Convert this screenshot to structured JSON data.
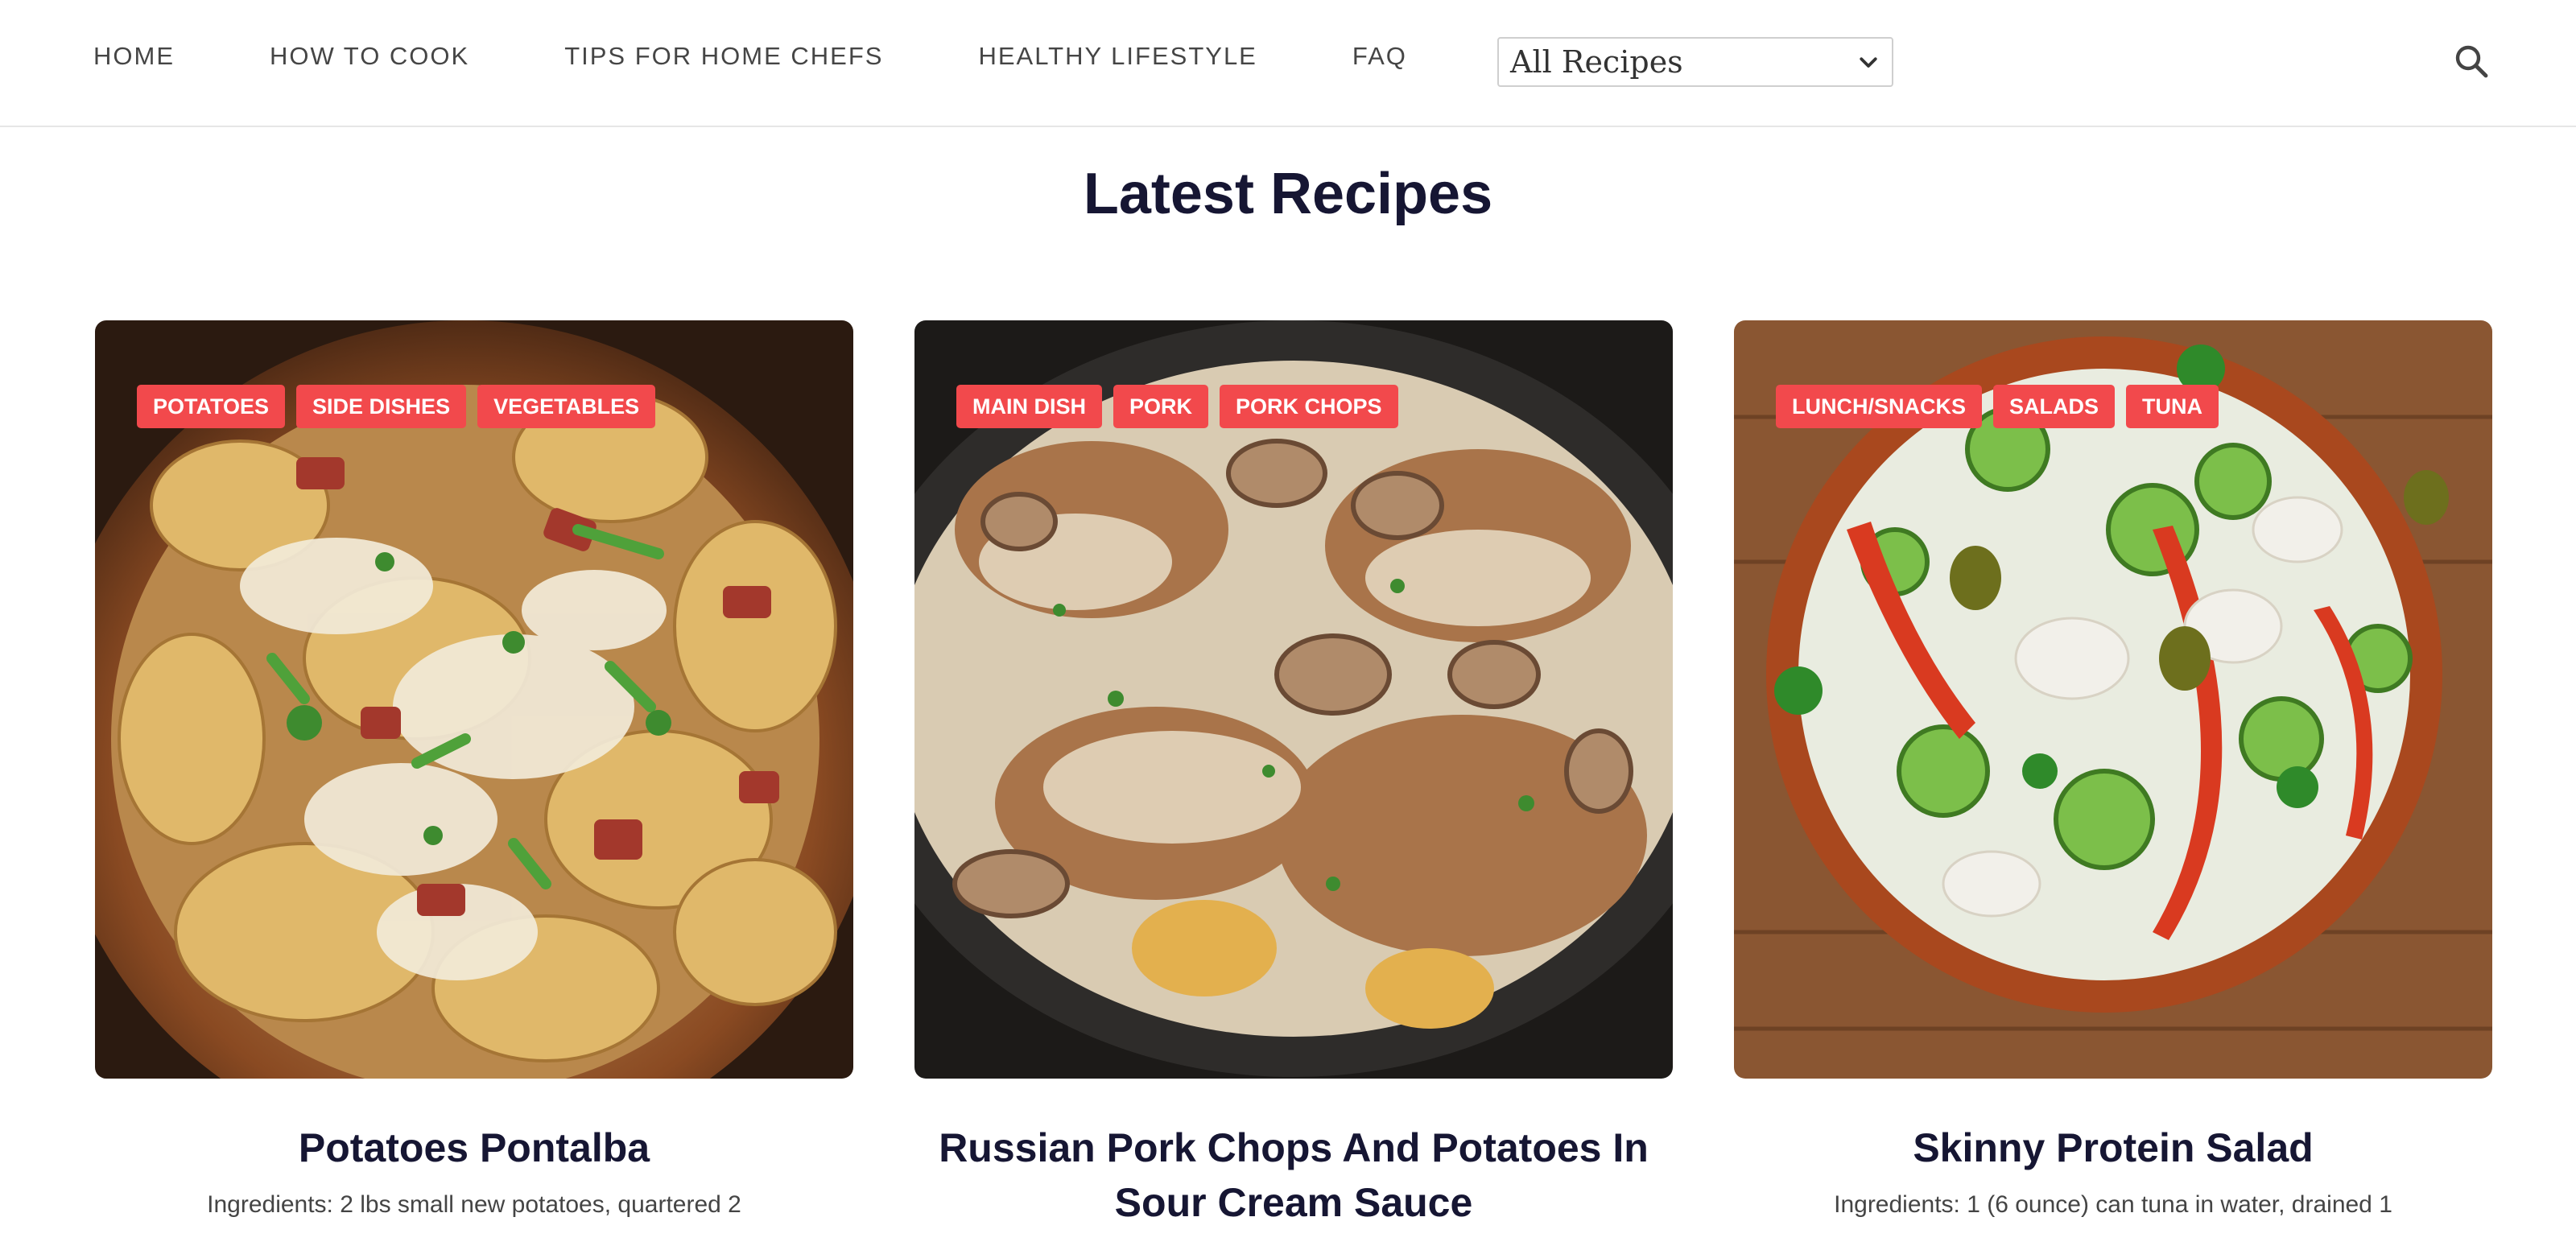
{
  "nav": {
    "items": [
      {
        "label": "HOME"
      },
      {
        "label": "HOW TO COOK"
      },
      {
        "label": "TIPS FOR HOME CHEFS"
      },
      {
        "label": "HEALTHY LIFESTYLE"
      },
      {
        "label": "FAQ"
      }
    ],
    "select": {
      "value": "All Recipes"
    },
    "search_icon": "search-icon"
  },
  "section": {
    "title": "Latest Recipes"
  },
  "cards": [
    {
      "tags": [
        "POTATOES",
        "SIDE DISHES",
        "VEGETABLES"
      ],
      "title": "Potatoes Pontalba",
      "excerpt": "Ingredients: 2 lbs small new potatoes, quartered 2",
      "image_alt": "potatoes-pontalba-photo"
    },
    {
      "tags": [
        "MAIN DISH",
        "PORK",
        "PORK CHOPS"
      ],
      "title": "Russian Pork Chops And Potatoes In Sour Cream Sauce",
      "excerpt": "",
      "image_alt": "pork-chops-photo"
    },
    {
      "tags": [
        "LUNCH/SNACKS",
        "SALADS",
        "TUNA"
      ],
      "title": "Skinny Protein Salad",
      "excerpt": "Ingredients: 1 (6 ounce) can tuna in water, drained 1",
      "image_alt": "protein-salad-photo"
    }
  ],
  "colors": {
    "tag_bg": "#f2494c",
    "title": "#161633",
    "nav_text": "#454545"
  }
}
